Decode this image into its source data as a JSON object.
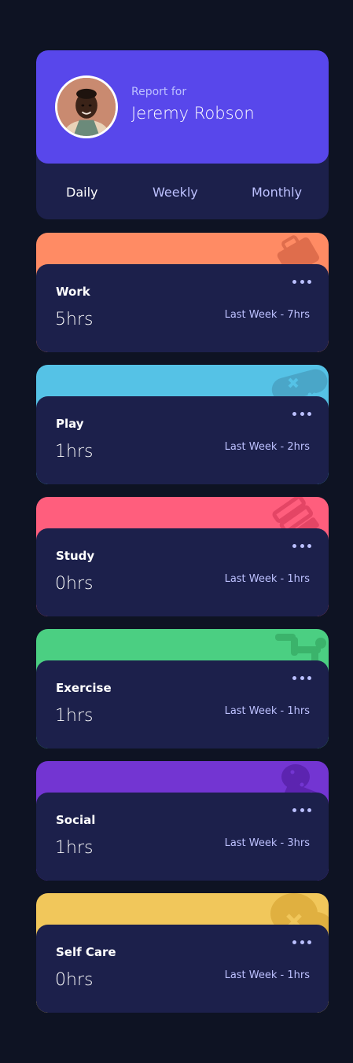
{
  "profile": {
    "report_for": "Report for",
    "name": "Jeremy Robson"
  },
  "tabs": [
    {
      "label": "Daily",
      "active": true
    },
    {
      "label": "Weekly",
      "active": false
    },
    {
      "label": "Monthly",
      "active": false
    }
  ],
  "activities": [
    {
      "title": "Work",
      "hours": "5hrs",
      "previous": "Last Week - 7hrs",
      "color": "#ff8b64",
      "icon": "briefcase-icon"
    },
    {
      "title": "Play",
      "hours": "1hrs",
      "previous": "Last Week - 2hrs",
      "color": "#55c2e6",
      "icon": "gamepad-icon"
    },
    {
      "title": "Study",
      "hours": "0hrs",
      "previous": "Last Week - 1hrs",
      "color": "#ff5e7d",
      "icon": "books-icon"
    },
    {
      "title": "Exercise",
      "hours": "1hrs",
      "previous": "Last Week - 1hrs",
      "color": "#4bcf82",
      "icon": "runner-icon"
    },
    {
      "title": "Social",
      "hours": "1hrs",
      "previous": "Last Week - 3hrs",
      "color": "#7335d2",
      "icon": "chat-bubble-icon"
    },
    {
      "title": "Self Care",
      "hours": "0hrs",
      "previous": "Last Week - 1hrs",
      "color": "#f1c75b",
      "icon": "heart-icon"
    }
  ],
  "colors": {
    "background": "#0e1323",
    "card": "#1c204b",
    "accent": "#5847eb",
    "muted_text": "#bdc1ff"
  }
}
